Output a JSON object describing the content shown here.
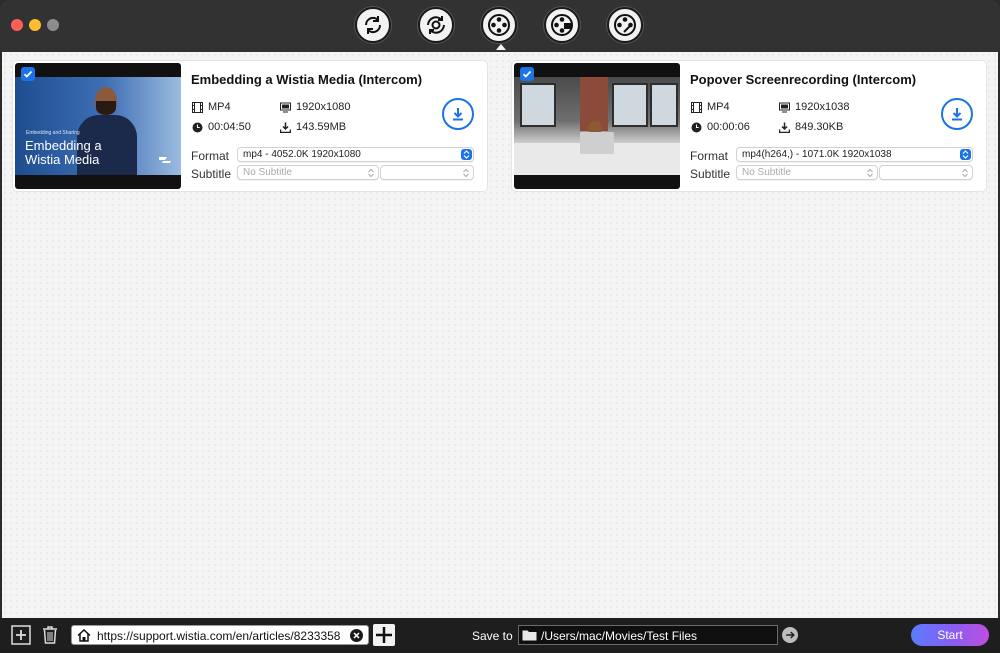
{
  "window": {
    "toolbar": [
      {
        "name": "convert-icon"
      },
      {
        "name": "reconvert-icon"
      },
      {
        "name": "download-film-icon",
        "active": true
      },
      {
        "name": "record-film-icon"
      },
      {
        "name": "edit-film-icon"
      }
    ]
  },
  "videos": [
    {
      "title": "Embedding a Wistia Media (Intercom)",
      "format": "MP4",
      "resolution": "1920x1080",
      "duration": "00:04:50",
      "size": "143.59MB",
      "format_label": "Format",
      "format_value": "mp4 - 4052.0K 1920x1080",
      "subtitle_label": "Subtitle",
      "subtitle_value": "No Subtitle",
      "thumb_small_text": "Embedding and Sharing",
      "thumb_big_text": "Embedding a Wistia Media",
      "checked": true
    },
    {
      "title": "Popover Screenrecording (Intercom)",
      "format": "MP4",
      "resolution": "1920x1038",
      "duration": "00:00:06",
      "size": "849.30KB",
      "format_label": "Format",
      "format_value": "mp4(h264,) - 1071.0K 1920x1038",
      "subtitle_label": "Subtitle",
      "subtitle_value": "No Subtitle",
      "checked": true
    }
  ],
  "bottom": {
    "url_value": "https://support.wistia.com/en/articles/8233358",
    "save_to_label": "Save to",
    "save_path": "/Users/mac/Movies/Test Files",
    "start_label": "Start"
  },
  "colors": {
    "accent": "#1a73e8",
    "start_gradient": [
      "#5a7cff",
      "#c04ee0"
    ]
  }
}
